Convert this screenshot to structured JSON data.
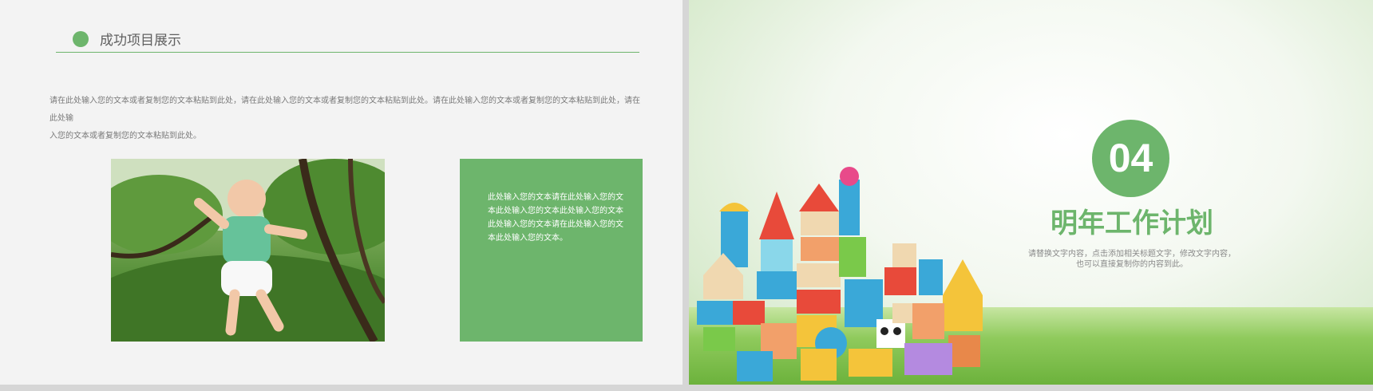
{
  "left_slide": {
    "title": "成功项目展示",
    "body_line1": "请在此处输入您的文本或者复制您的文本粘贴到此处，请在此处输入您的文本或者复制您的文本粘贴到此处。请在此处输入您的文本或者复制您的文本粘贴到此处，请在此处输",
    "body_line2": "入您的文本或者复制您的文本粘贴到此处。",
    "box_line1": "此处输入您的文本请在此处输入您的文",
    "box_line2": "本此处输入您的文本此处输入您的文本",
    "box_line3": "此处输入您的文本请在此处输入您的文",
    "box_line4": "本此处输入您的文本。",
    "accent_color": "#6db56c"
  },
  "right_slide": {
    "number": "04",
    "heading": "明年工作计划",
    "sub_line1": "请替换文字内容，点击添加相关标题文字，修改文字内容，",
    "sub_line2": "也可以直接复制你的内容到此。",
    "accent_color": "#6db56c"
  }
}
